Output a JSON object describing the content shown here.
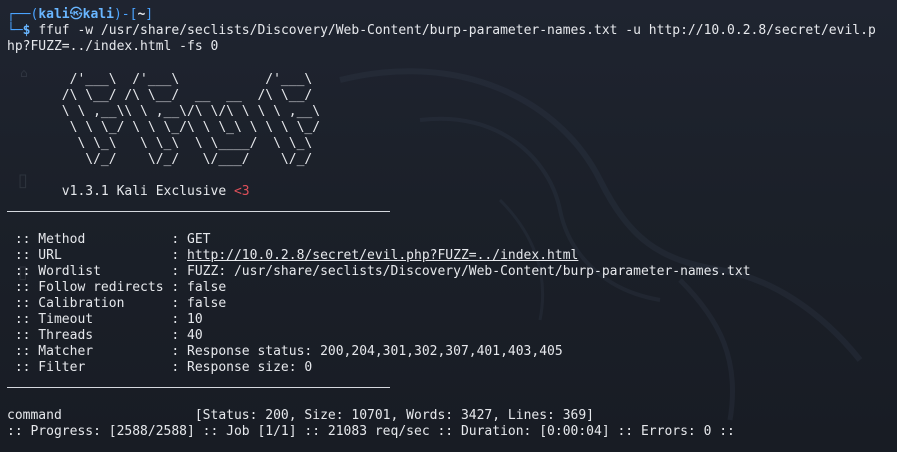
{
  "prompt": {
    "user": "kali",
    "at": "㉿",
    "host": "kali",
    "path": "~",
    "symbol": "$"
  },
  "command": {
    "line1": "ffuf -w /usr/share/seclists/Discovery/Web-Content/burp-parameter-names.txt -u http://10.0.2.8/secret/evil.p",
    "line2": "hp?FUZZ=../index.html -fs 0"
  },
  "banner": {
    "art": [
      "        /'___\\  /'___\\           /'___\\",
      "       /\\ \\__/ /\\ \\__/  __  __  /\\ \\__/",
      "       \\ \\ ,__\\\\ \\ ,__\\/\\ \\/\\ \\ \\ \\ ,__\\",
      "        \\ \\ \\_/ \\ \\ \\_/\\ \\ \\_\\ \\ \\ \\ \\_/",
      "         \\ \\_\\   \\ \\_\\  \\ \\____/  \\ \\_\\",
      "          \\/_/    \\/_/   \\/___/    \\/_/"
    ],
    "version": "       v1.3.1 Kali Exclusive ",
    "heart": "<3"
  },
  "config": [
    {
      "key": " :: Method           : ",
      "value": "GET"
    },
    {
      "key": " :: URL              : ",
      "value": "http://10.0.2.8/secret/evil.php?FUZZ=../index.html"
    },
    {
      "key": " :: Wordlist         : ",
      "value": "FUZZ: /usr/share/seclists/Discovery/Web-Content/burp-parameter-names.txt"
    },
    {
      "key": " :: Follow redirects : ",
      "value": "false"
    },
    {
      "key": " :: Calibration      : ",
      "value": "false"
    },
    {
      "key": " :: Timeout          : ",
      "value": "10"
    },
    {
      "key": " :: Threads          : ",
      "value": "40"
    },
    {
      "key": " :: Matcher          : ",
      "value": "Response status: 200,204,301,302,307,401,403,405"
    },
    {
      "key": " :: Filter           : ",
      "value": "Response size: 0"
    }
  ],
  "result": {
    "word": "command                 ",
    "status": "[Status: 200, Size: 10701, Words: 3427, Lines: 369]"
  },
  "progress": ":: Progress: [2588/2588] :: Job [1/1] :: 21083 req/sec :: Duration: [0:00:04] :: Errors: 0 ::",
  "colors": {
    "background": "#1b2029",
    "prompt_blue": "#4aa3ff",
    "heart_red": "#e0505a",
    "text": "#e6e8ec"
  }
}
